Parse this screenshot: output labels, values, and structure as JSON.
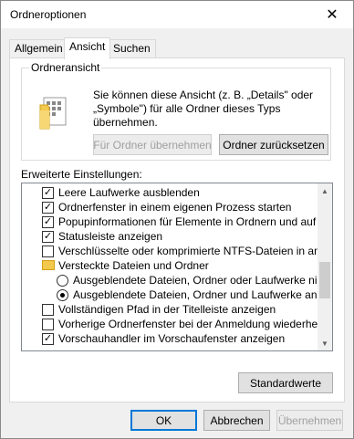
{
  "window": {
    "title": "Ordneroptionen",
    "close_glyph": "✕"
  },
  "tabs": [
    {
      "label": "Allgemein",
      "active": false
    },
    {
      "label": "Ansicht",
      "active": true
    },
    {
      "label": "Suchen",
      "active": false
    }
  ],
  "folder_view": {
    "legend": "Ordneransicht",
    "description": "Sie können diese Ansicht (z. B. „Details\" oder „Symbole\") für alle Ordner dieses Typs übernehmen.",
    "apply_button": "Für Ordner übernehmen",
    "reset_button": "Ordner zurücksetzen",
    "icon": "folder-icon"
  },
  "advanced": {
    "label": "Erweiterte Einstellungen:",
    "items": [
      {
        "type": "checkbox",
        "checked": true,
        "label": "Leere Laufwerke ausblenden"
      },
      {
        "type": "checkbox",
        "checked": true,
        "label": "Ordnerfenster in einem eigenen Prozess starten"
      },
      {
        "type": "checkbox",
        "checked": true,
        "label": "Popupinformationen für Elemente in Ordnern und auf dem D"
      },
      {
        "type": "checkbox",
        "checked": true,
        "label": "Statusleiste anzeigen"
      },
      {
        "type": "checkbox",
        "checked": false,
        "label": "Verschlüsselte oder komprimierte NTFS-Dateien in anderer"
      },
      {
        "type": "folder",
        "label": "Versteckte Dateien und Ordner"
      },
      {
        "type": "radio",
        "checked": false,
        "label": "Ausgeblendete Dateien, Ordner oder Laufwerke nicht a"
      },
      {
        "type": "radio",
        "checked": true,
        "label": "Ausgeblendete Dateien, Ordner und Laufwerke anzeig"
      },
      {
        "type": "checkbox",
        "checked": false,
        "label": "Vollständigen Pfad in der Titelleiste anzeigen"
      },
      {
        "type": "checkbox",
        "checked": false,
        "label": "Vorherige Ordnerfenster bei der Anmeldung wiederherstellen"
      },
      {
        "type": "checkbox",
        "checked": true,
        "label": "Vorschauhandler im Vorschaufenster anzeigen"
      }
    ],
    "restore_defaults": "Standardwerte"
  },
  "footer": {
    "ok": "OK",
    "cancel": "Abbrechen",
    "apply": "Übernehmen"
  },
  "colors": {
    "accent": "#0078d7",
    "folder": "#f2c94c"
  }
}
